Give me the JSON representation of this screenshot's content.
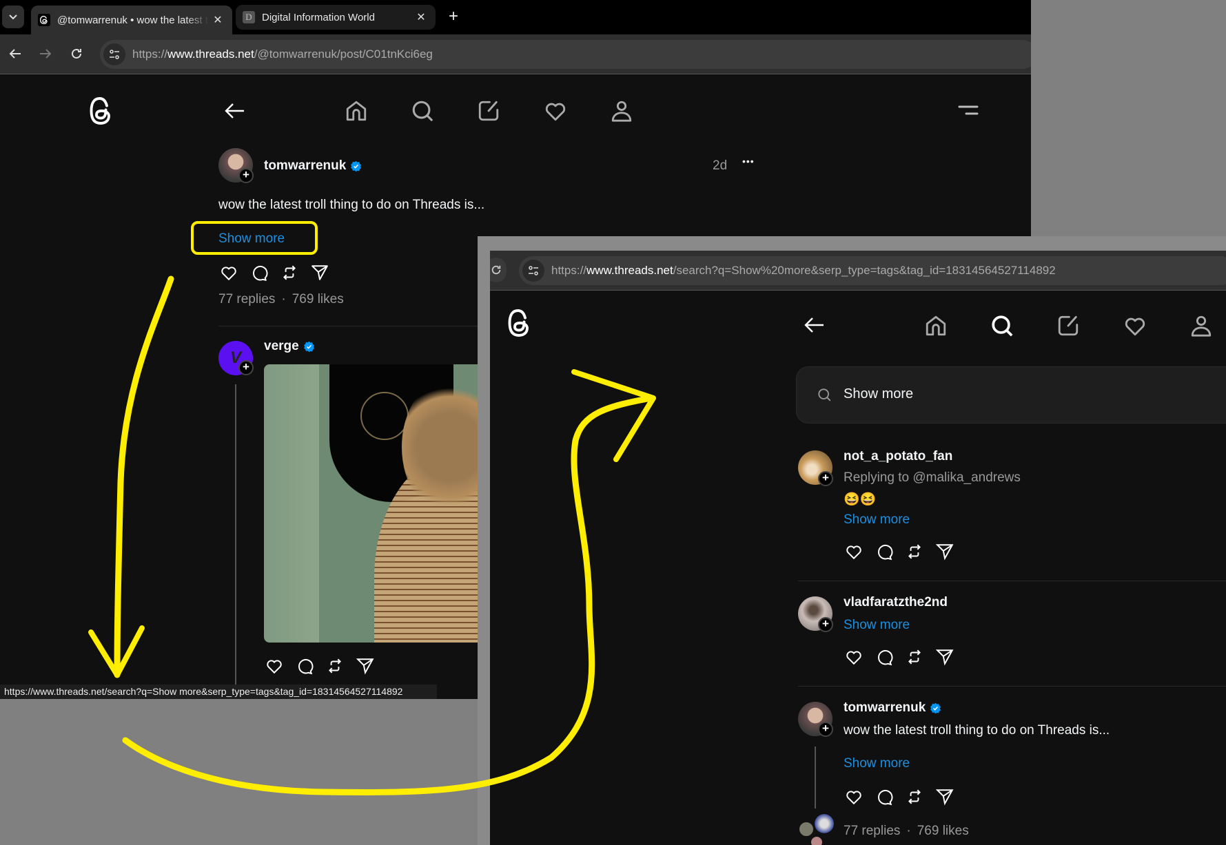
{
  "window1": {
    "tabs": [
      {
        "title": "@tomwarrenuk • wow the latest troll thing to do on Threads is...",
        "favicon": "threads-icon",
        "active": true
      },
      {
        "title": "Digital Information World",
        "favicon": "D",
        "active": false
      }
    ],
    "tab_list_icon": "chevron-down-icon",
    "new_tab_label": "+",
    "close_label": "✕",
    "url": {
      "scheme": "https://",
      "host": "www.threads.net",
      "path": "/@tomwarrenuk/post/C01tnKci6eg"
    },
    "nav": [
      "back-icon",
      "home-icon",
      "search-icon",
      "compose-icon",
      "heart-icon",
      "profile-icon"
    ],
    "menu_icon": "menu-icon",
    "post": {
      "username": "tomwarrenuk",
      "verified": true,
      "age": "2d",
      "more_label": "•••",
      "text": "wow the latest troll thing to do on Threads is...",
      "show_more": "Show more",
      "replies": "77 replies",
      "likes": "769 likes",
      "separator": "·"
    },
    "reply": {
      "username": "verge",
      "verified": true
    },
    "status_url": "https://www.threads.net/search?q=Show more&serp_type=tags&tag_id=18314564527114892"
  },
  "window2": {
    "url": {
      "scheme": "https://",
      "host": "www.threads.net",
      "path": "/search?q=Show%20more&serp_type=tags&tag_id=18314564527114892"
    },
    "active_nav": "search",
    "search": {
      "value": "Show more"
    },
    "results": [
      {
        "username": "not_a_potato_fan",
        "verified": false,
        "replying": "Replying to @malika_andrews",
        "emoji": "😆😆",
        "show_more": "Show more"
      },
      {
        "username": "vladfaratzthe2nd",
        "verified": false,
        "show_more": "Show more"
      },
      {
        "username": "tomwarrenuk",
        "verified": true,
        "text": "wow the latest troll thing to do on Threads is...",
        "show_more": "Show more",
        "replies": "77 replies",
        "likes": "769 likes",
        "separator": "·"
      }
    ]
  },
  "annotations": {
    "highlight_color": "#ffee00",
    "highlight_target": "Show more",
    "arrows": [
      "down-arrow",
      "curved-arrow-to-search-window"
    ]
  },
  "colors": {
    "link": "#1d8fe0",
    "verified": "#0095f6",
    "background": "#101010",
    "annotation": "#ffee00"
  }
}
